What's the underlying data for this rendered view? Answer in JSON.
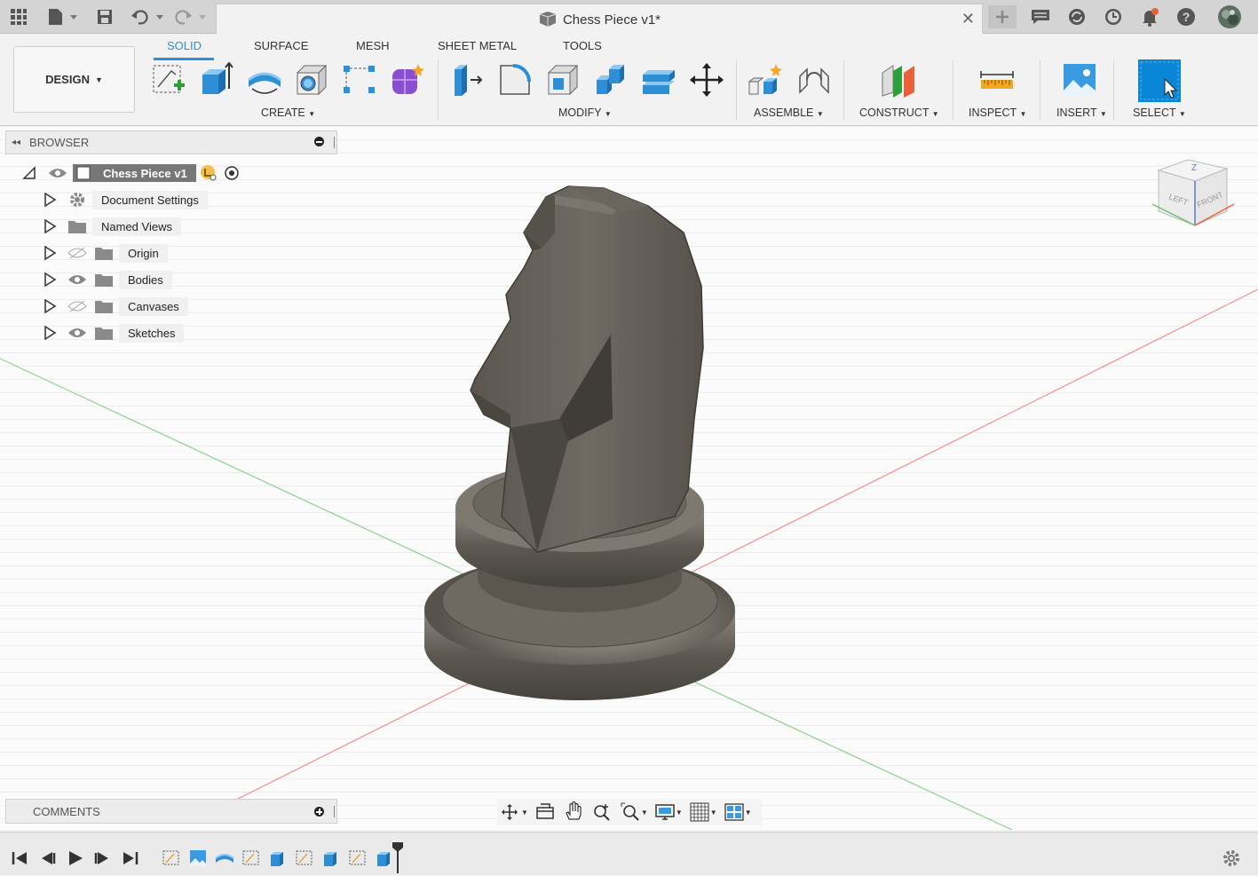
{
  "title_bar": {
    "document_title": "Chess Piece v1*",
    "icons": [
      "grid-icon",
      "file-icon",
      "save-icon",
      "undo-icon",
      "redo-icon",
      "new-tab-icon",
      "comment-icon",
      "extensions-icon",
      "history-icon",
      "notifications-icon",
      "help-icon",
      "avatar"
    ]
  },
  "ribbon": {
    "workspace": "DESIGN",
    "tabs": [
      "SOLID",
      "SURFACE",
      "MESH",
      "SHEET METAL",
      "TOOLS"
    ],
    "active_tab": "SOLID",
    "groups": {
      "create": "CREATE",
      "modify": "MODIFY",
      "assemble": "ASSEMBLE",
      "construct": "CONSTRUCT",
      "inspect": "INSPECT",
      "insert": "INSERT",
      "select": "SELECT"
    },
    "accent": "#2f8fd6"
  },
  "browser": {
    "title": "BROWSER",
    "root": "Chess Piece v1",
    "items": [
      {
        "label": "Document Settings",
        "icon": "gear-icon"
      },
      {
        "label": "Named Views",
        "icon": "folder-icon"
      },
      {
        "label": "Origin",
        "icon": "folder-icon",
        "visibility": "hidden"
      },
      {
        "label": "Bodies",
        "icon": "folder-icon",
        "visibility": "visible"
      },
      {
        "label": "Canvases",
        "icon": "folder-icon",
        "visibility": "hidden"
      },
      {
        "label": "Sketches",
        "icon": "folder-icon",
        "visibility": "visible"
      }
    ]
  },
  "viewcube": {
    "left": "LEFT",
    "front": "FRONT"
  },
  "comments": {
    "title": "COMMENTS"
  },
  "navbar": {
    "icons": [
      "orbit-icon",
      "look-at-icon",
      "pan-icon",
      "zoom-icon",
      "fit-icon",
      "display-settings-icon",
      "grid-settings-icon",
      "viewports-icon"
    ]
  },
  "timeline": {
    "controls": [
      "first-icon",
      "previous-icon",
      "play-icon",
      "next-icon",
      "last-icon"
    ],
    "settings": "gear-icon"
  }
}
